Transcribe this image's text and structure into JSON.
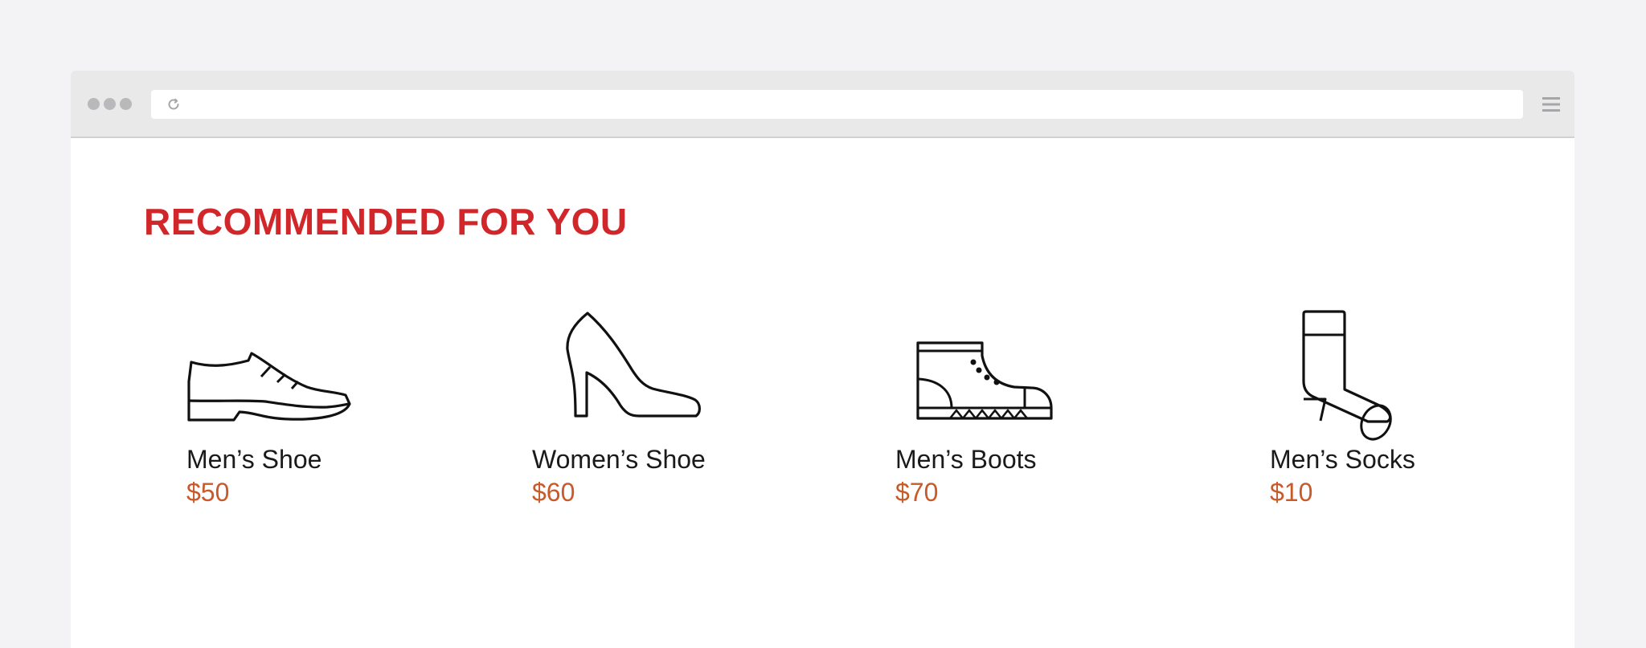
{
  "browser": {
    "address_value": "",
    "icons": {
      "window_controls": "three-dots-icon",
      "reload": "reload-icon",
      "menu": "hamburger-menu-icon"
    }
  },
  "section": {
    "title": "RECOMMENDED FOR YOU"
  },
  "colors": {
    "title": "#d1272b",
    "price": "#c85a2a",
    "toolbar": "#e9e9ea",
    "page_background": "#f3f3f5"
  },
  "products": [
    {
      "name": "Men’s Shoe",
      "price": "$50",
      "icon": "mens-shoe-icon"
    },
    {
      "name": "Women’s Shoe",
      "price": "$60",
      "icon": "womens-shoe-icon"
    },
    {
      "name": "Men’s Boots",
      "price": "$70",
      "icon": "mens-boots-icon"
    },
    {
      "name": "Men’s Socks",
      "price": "$10",
      "icon": "mens-socks-icon"
    }
  ]
}
